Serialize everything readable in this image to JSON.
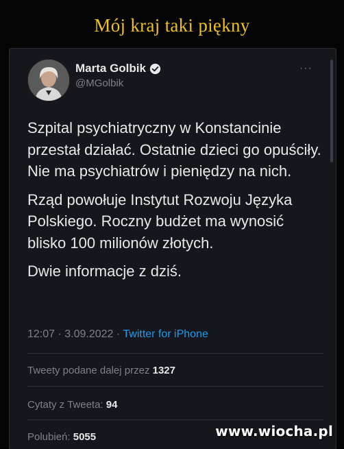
{
  "caption": "Mój kraj taki piękny",
  "tweet": {
    "author": {
      "display_name": "Marta Golbik",
      "handle": "@MGolbik"
    },
    "more_label": "···",
    "paragraphs": [
      "Szpital psychiatryczny w Konstancinie przestał działać. Ostatnie dzieci go opuściły. Nie ma psychiatrów i pieniędzy na nich.",
      "Rząd powołuje Instytut Rozwoju Języka Polskiego. Roczny budżet ma wynosić blisko 100 milionów złotych.",
      "Dwie informacje z dziś."
    ],
    "time": "12:07 · 3.09.2022 · ",
    "source": "Twitter for iPhone",
    "stats": {
      "retweets_label": "Tweety podane dalej przez",
      "retweets_value": "1327",
      "quotes_label": "Cytaty z Tweeta:",
      "quotes_value": "94",
      "likes_label": "Polubień:",
      "likes_value": "5055"
    }
  },
  "watermark": "www.wiocha.pl",
  "colors": {
    "caption": "#f0c020",
    "link": "#1d9bf0",
    "card_bg": "#15171c",
    "muted_text": "#7d828a"
  }
}
